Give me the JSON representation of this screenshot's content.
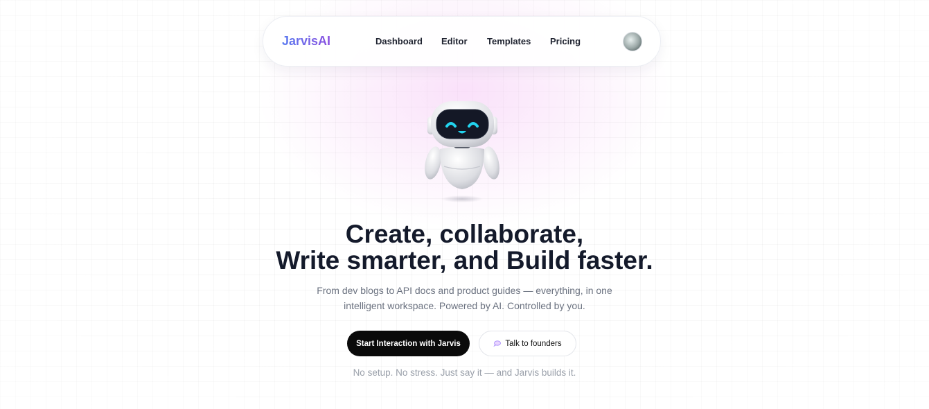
{
  "brand": {
    "name": "JarvisAI"
  },
  "nav": {
    "links": [
      "Dashboard",
      "Editor",
      "Templates",
      "Pricing"
    ]
  },
  "hero": {
    "headline_line1": "Create, collaborate,",
    "headline_line2": "Write smarter, and Build faster.",
    "sub_line1": "From dev blogs to API docs and product guides — everything, in one",
    "sub_line2": "intelligent workspace. Powered by AI. Controlled by you.",
    "primary_cta": "Start Interaction with Jarvis",
    "secondary_cta": "Talk to founders",
    "tagline": "No setup. No stress. Just say it — and Jarvis builds it."
  },
  "icons": {
    "avatar": "user-avatar",
    "robot": "robot-mascot",
    "chat": "speech-bubble-icon"
  },
  "colors": {
    "brand_gradient_start": "#5b7cf0",
    "brand_gradient_end": "#8a4fe0",
    "primary_button": "#0a0a0a",
    "robot_eyes": "#22d3ee"
  }
}
